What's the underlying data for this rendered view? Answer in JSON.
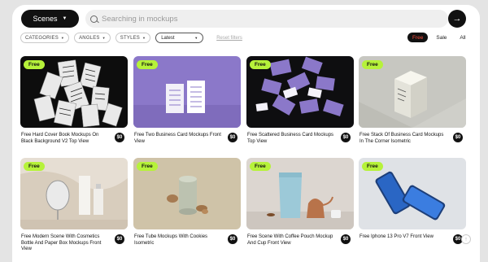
{
  "search": {
    "scope_label": "Scenes",
    "placeholder": "Searching in mockups"
  },
  "filters": {
    "categories_label": "CATEGORIES",
    "angles_label": "ANGLES",
    "styles_label": "STYLES",
    "sort_value": "Latest",
    "reset_label": "Reset filters"
  },
  "price_tabs": [
    "Free",
    "Sale",
    "All"
  ],
  "active_price_tab": "Free",
  "cards": [
    {
      "badge": "Free",
      "title": "Free Hard Cover Book Mockups On Black Background V2 Top View",
      "price": "$0"
    },
    {
      "badge": "Free",
      "title": "Free Two Business Card Mockups Front View",
      "price": "$0"
    },
    {
      "badge": "Free",
      "title": "Free Scattered Business Card Mockups Top View",
      "price": "$0"
    },
    {
      "badge": "Free",
      "title": "Free Stack Of Business Card Mockups In The Corner Isometric",
      "price": "$0"
    },
    {
      "badge": "Free",
      "title": "Free Modern Scene With Cosmetics Bottle And Paper Box Mockups Front View",
      "price": "$0"
    },
    {
      "badge": "Free",
      "title": "Free Tube Mockups With Cookies Isometric",
      "price": "$0"
    },
    {
      "badge": "Free",
      "title": "Free Scene With Coffee Pouch Mockup And Cup Front View",
      "price": "$0"
    },
    {
      "badge": "Free",
      "title": "Free Iphone 13 Pro V7 Front View",
      "price": "$0"
    }
  ],
  "colors": {
    "badge_green": "#b6f23a",
    "purple": "#8b78c9",
    "dark": "#111111"
  }
}
